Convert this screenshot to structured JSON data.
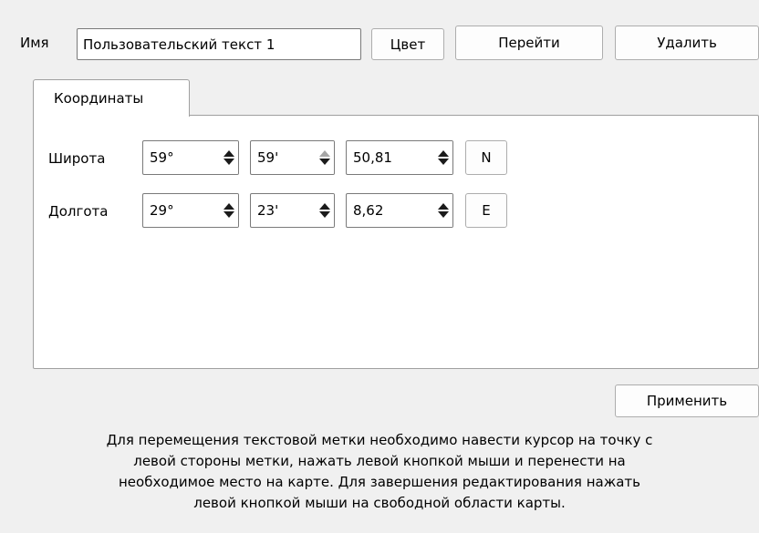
{
  "header": {
    "name_label": "Имя",
    "name_value": "Пользовательский текст 1",
    "color_button": "Цвет",
    "goto_button": "Перейти",
    "delete_button": "Удалить"
  },
  "tabs": [
    {
      "label": "Координаты",
      "active": true
    }
  ],
  "coordinates": {
    "latitude": {
      "label": "Широта",
      "degrees": "59°",
      "minutes": "59'",
      "seconds": "50,81",
      "hemisphere": "N",
      "minutes_up_disabled": true
    },
    "longitude": {
      "label": "Долгота",
      "degrees": "29°",
      "minutes": "23'",
      "seconds": "8,62",
      "hemisphere": "E",
      "minutes_up_disabled": false
    }
  },
  "apply_button": "Применить",
  "instructions": [
    "Для перемещения текстовой метки необходимо навести курсор на точку с",
    "левой стороны метки, нажать левой кнопкой мыши и перенести на",
    "необходимое место на карте. Для завершения редактирования нажать",
    "левой кнопкой мыши на свободной области карты."
  ]
}
